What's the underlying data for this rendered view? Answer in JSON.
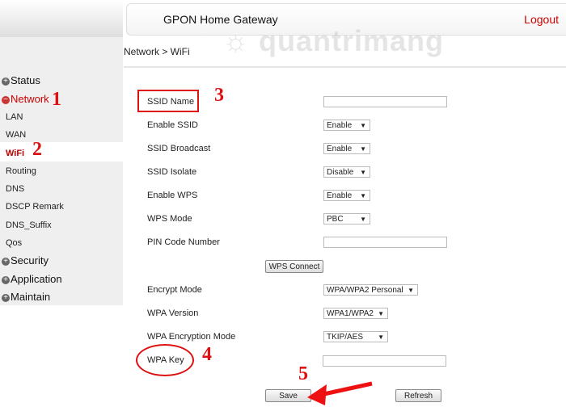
{
  "header": {
    "title": "GPON Home Gateway",
    "logout": "Logout"
  },
  "breadcrumb": "Network > WiFi",
  "watermark": "quantrimang",
  "sidebar": {
    "groups": [
      {
        "label": "Status",
        "icon": "plus-icon"
      },
      {
        "label": "Network",
        "icon": "minus-icon",
        "items": [
          "LAN",
          "WAN",
          "WiFi",
          "Routing",
          "DNS",
          "DSCP Remark",
          "DNS_Suffix",
          "Qos"
        ]
      },
      {
        "label": "Security",
        "icon": "plus-icon"
      },
      {
        "label": "Application",
        "icon": "plus-icon"
      },
      {
        "label": "Maintain",
        "icon": "plus-icon"
      }
    ]
  },
  "form": {
    "ssid_name": {
      "label": "SSID Name",
      "value": ""
    },
    "enable_ssid": {
      "label": "Enable SSID",
      "value": "Enable"
    },
    "ssid_broadcast": {
      "label": "SSID Broadcast",
      "value": "Enable"
    },
    "ssid_isolate": {
      "label": "SSID Isolate",
      "value": "Disable"
    },
    "enable_wps": {
      "label": "Enable WPS",
      "value": "Enable"
    },
    "wps_mode": {
      "label": "WPS Mode",
      "value": "PBC"
    },
    "pin_code": {
      "label": "PIN Code Number",
      "value": ""
    },
    "wps_connect": "WPS Connect",
    "encrypt_mode": {
      "label": "Encrypt Mode",
      "value": "WPA/WPA2 Personal"
    },
    "wpa_version": {
      "label": "WPA Version",
      "value": "WPA1/WPA2"
    },
    "wpa_encryption_mode": {
      "label": "WPA Encryption Mode",
      "value": "TKIP/AES"
    },
    "wpa_key": {
      "label": "WPA Key",
      "value": ""
    },
    "save": "Save",
    "refresh": "Refresh"
  },
  "annotations": [
    "1",
    "2",
    "3",
    "4",
    "5"
  ],
  "colors": {
    "accent": "#cc0000",
    "annotation": "#dd1111"
  }
}
